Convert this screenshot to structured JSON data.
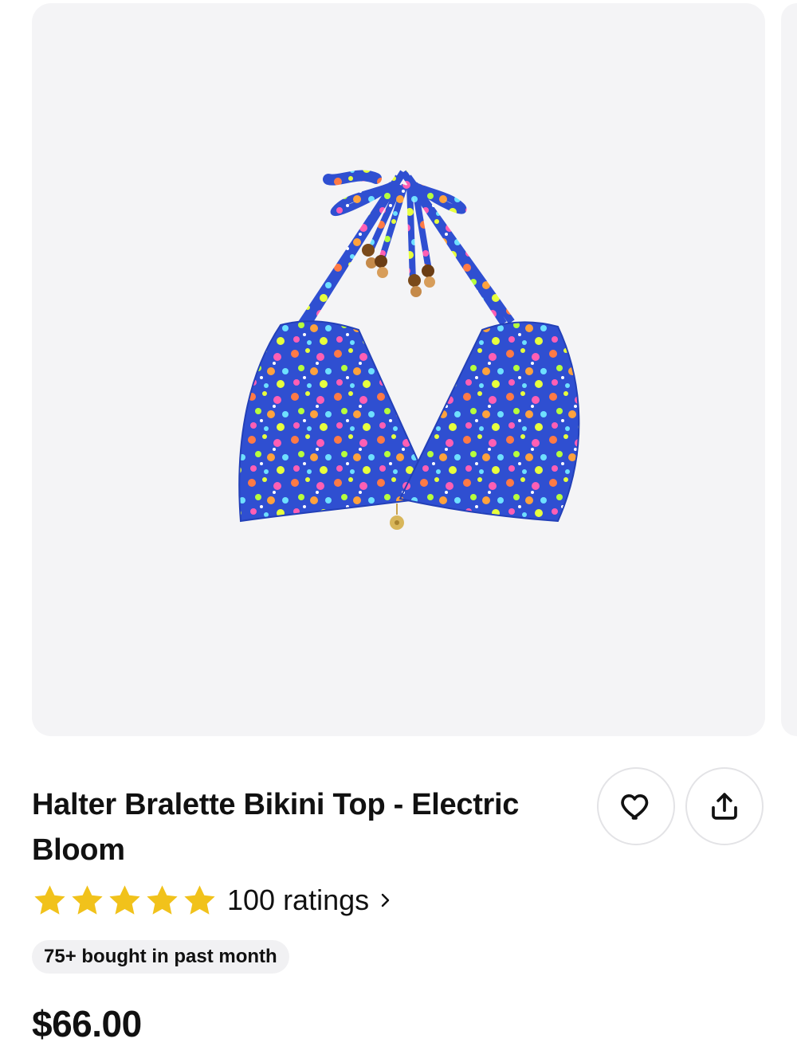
{
  "product": {
    "title": "Halter Bralette Bikini Top - Electric Bloom",
    "image_alt": "Halter Bralette Bikini Top - Electric Bloom",
    "rating": 5,
    "rating_max": 5,
    "ratings_label": "100 ratings",
    "badge": "75+ bought in past month",
    "price": "$66.00"
  },
  "icons": {
    "favorite": "heart-icon",
    "share": "share-icon",
    "star": "star-icon",
    "chevron": "chevron-right-icon"
  },
  "colors": {
    "gallery_bg": "#f4f4f6",
    "star": "#f1c21b",
    "badge_bg": "#f1f1f3",
    "button_border": "#e3e3e6"
  }
}
